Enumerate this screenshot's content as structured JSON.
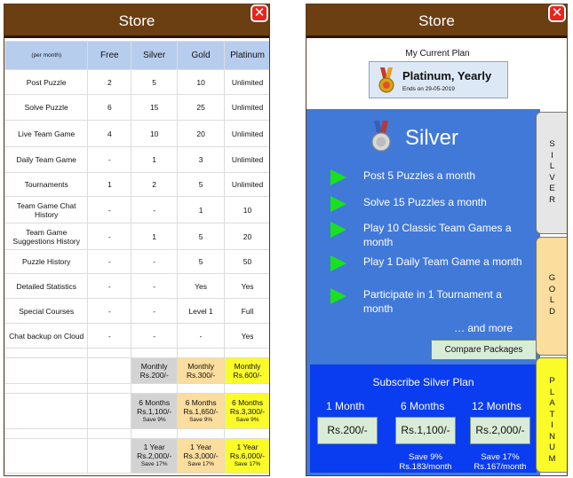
{
  "left": {
    "title": "Store",
    "close_label": "✕",
    "columns": [
      "(per month)",
      "Free",
      "Silver",
      "Gold",
      "Platinum"
    ],
    "rows": [
      {
        "feature": "Post Puzzle",
        "values": [
          "2",
          "5",
          "10",
          "Unlimited"
        ]
      },
      {
        "feature": "Solve Puzzle",
        "values": [
          "6",
          "15",
          "25",
          "Unlimited"
        ]
      },
      {
        "feature": "Live Team Game",
        "values": [
          "4",
          "10",
          "20",
          "Unlimited"
        ]
      },
      {
        "feature": "Daily Team Game",
        "values": [
          "-",
          "1",
          "3",
          "Unlimited"
        ]
      },
      {
        "feature": "Tournaments",
        "values": [
          "1",
          "2",
          "5",
          "Unlimited"
        ]
      },
      {
        "feature": "Team Game Chat History",
        "values": [
          "-",
          "-",
          "1",
          "10"
        ]
      },
      {
        "feature": "Team Game Suggestions History",
        "values": [
          "-",
          "1",
          "5",
          "20"
        ]
      },
      {
        "feature": "Puzzle History",
        "values": [
          "-",
          "-",
          "5",
          "50"
        ]
      },
      {
        "feature": "Detailed Statistics",
        "values": [
          "-",
          "-",
          "Yes",
          "Yes"
        ]
      },
      {
        "feature": "Special Courses",
        "values": [
          "-",
          "-",
          "Level 1",
          "Full"
        ]
      },
      {
        "feature": "Chat backup on Cloud",
        "values": [
          "-",
          "-",
          "-",
          "Yes"
        ]
      }
    ],
    "pricing": [
      {
        "silver": {
          "label": "Monthly",
          "price": "Rs.200/-",
          "save": ""
        },
        "gold": {
          "label": "Monthly",
          "price": "Rs.300/-",
          "save": ""
        },
        "platinum": {
          "label": "Monthly",
          "price": "Rs.600/-",
          "save": ""
        }
      },
      {
        "silver": {
          "label": "6 Months",
          "price": "Rs.1,100/-",
          "save": "Save 9%"
        },
        "gold": {
          "label": "6 Months",
          "price": "Rs.1,650/-",
          "save": "Save 9%"
        },
        "platinum": {
          "label": "6 Months",
          "price": "Rs.3,300/-",
          "save": "Save 9%"
        }
      },
      {
        "silver": {
          "label": "1 Year",
          "price": "Rs.2,000/-",
          "save": "Save 17%"
        },
        "gold": {
          "label": "1 Year",
          "price": "Rs.3,000/-",
          "save": "Save 17%"
        },
        "platinum": {
          "label": "1 Year",
          "price": "Rs.6,000/-",
          "save": "Save 17%"
        }
      }
    ]
  },
  "right": {
    "title": "Store",
    "close_label": "✕",
    "my_plan_heading": "My Current Plan",
    "current_plan": {
      "name": "Platinum, Yearly",
      "ends": "Ends on 29-05-2019"
    },
    "tier_name": "Silver",
    "features": [
      "Post 5 Puzzles a month",
      "Solve 15 Puzzles a month",
      "Play 10 Classic Team Games a month",
      "Play 1 Daily Team Game a month",
      "Participate in 1 Tournament a month"
    ],
    "more_label": "… and more",
    "compare_button": "Compare Packages",
    "subscribe": {
      "title": "Subscribe Silver Plan",
      "options": [
        {
          "duration": "1 Month",
          "price": "Rs.200/-",
          "note1": "",
          "note2": ""
        },
        {
          "duration": "6 Months",
          "price": "Rs.1,100/-",
          "note1": "Save 9%",
          "note2": "Rs.183/month"
        },
        {
          "duration": "12 Months",
          "price": "Rs.2,000/-",
          "note1": "Save 17%",
          "note2": "Rs.167/month"
        }
      ]
    },
    "tabs": {
      "silver": "SILVER",
      "gold": "GOLD",
      "platinum": "PLATINUM"
    },
    "colors": {
      "panel": "#4179d8",
      "subscribe_bg": "#0a3cf0",
      "arrow": "#17e21c",
      "titlebar": "#6b3f12"
    }
  }
}
